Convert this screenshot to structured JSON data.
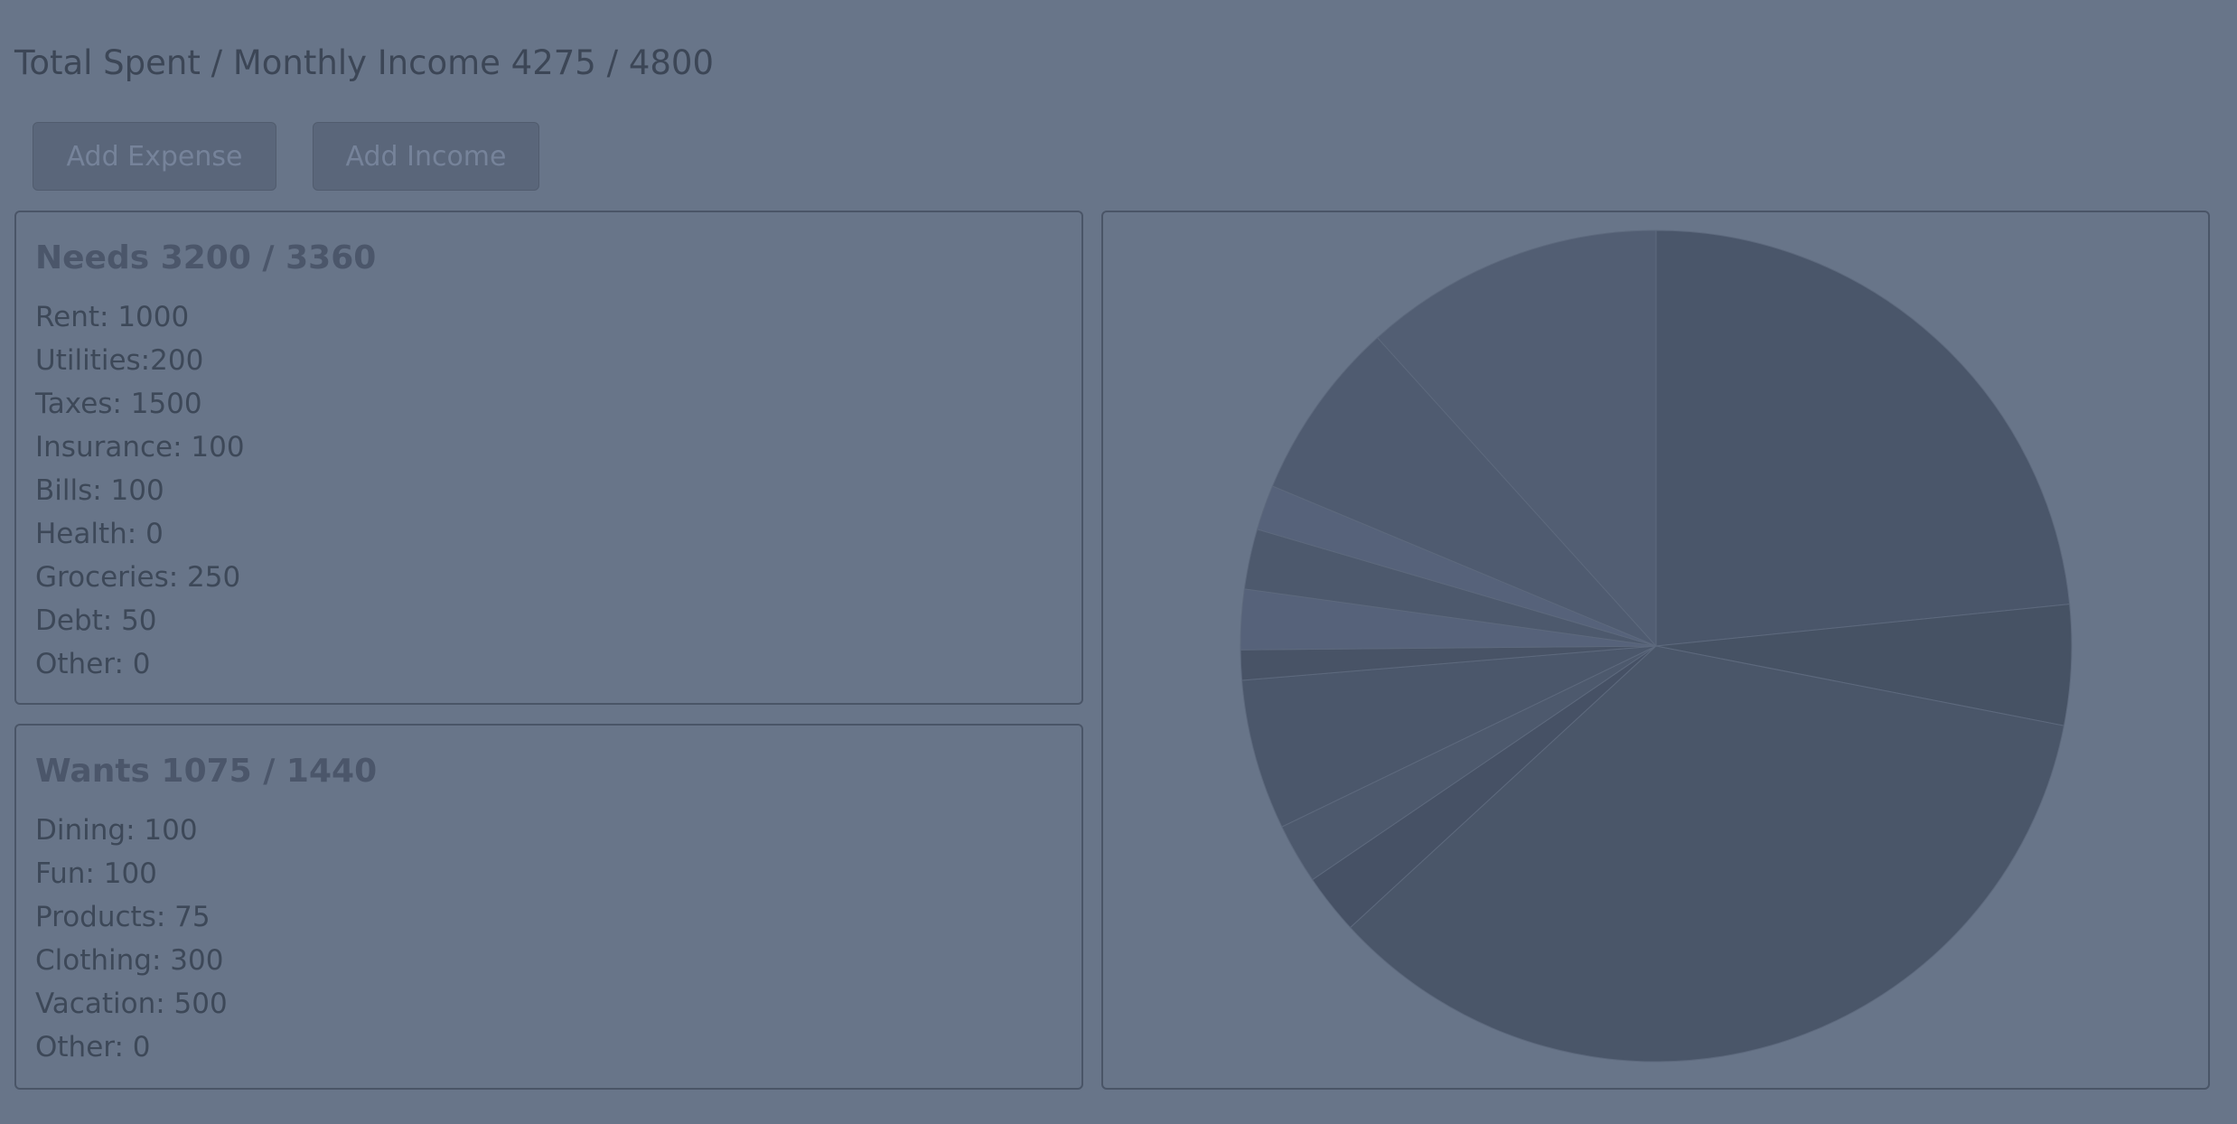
{
  "summary": "Total Spent / Monthly Income 4275 / 4800",
  "buttons": {
    "add_expense": "Add Expense",
    "add_income": "Add Income"
  },
  "needs": {
    "heading": "Needs 3200 / 3360",
    "items": [
      "Rent: 1000",
      "Utilities:200",
      "Taxes: 1500",
      "Insurance: 100",
      "Bills: 100",
      "Health: 0",
      "Groceries: 250",
      "Debt: 50",
      "Other: 0"
    ]
  },
  "wants": {
    "heading": "Wants 1075 / 1440",
    "items": [
      "Dining: 100",
      "Fun: 100",
      "Products: 75",
      "Clothing: 300",
      "Vacation: 500",
      "Other: 0"
    ]
  },
  "colors": {
    "background": "#687589",
    "button": "#5a667a",
    "text": "#3b4657"
  },
  "chart_data": {
    "type": "pie",
    "slices": [
      {
        "label": "Rent",
        "value": 1000,
        "color": "#4a566a"
      },
      {
        "label": "Utilities",
        "value": 200,
        "color": "#465264"
      },
      {
        "label": "Taxes",
        "value": 1500,
        "color": "#4a5669"
      },
      {
        "label": "Insurance",
        "value": 100,
        "color": "#465165"
      },
      {
        "label": "Bills",
        "value": 100,
        "color": "#4d596d"
      },
      {
        "label": "Health",
        "value": 0,
        "color": "#4c586c"
      },
      {
        "label": "Groceries",
        "value": 250,
        "color": "#4b576b"
      },
      {
        "label": "Debt",
        "value": 50,
        "color": "#485366"
      },
      {
        "label": "Other",
        "value": 0,
        "color": "#4c586c"
      },
      {
        "label": "Dining",
        "value": 100,
        "color": "#56627a"
      },
      {
        "label": "Fun",
        "value": 100,
        "color": "#4d596d"
      },
      {
        "label": "Products",
        "value": 75,
        "color": "#56627a"
      },
      {
        "label": "Clothing",
        "value": 300,
        "color": "#4f5b70"
      },
      {
        "label": "Vacation",
        "value": 500,
        "color": "#525e73"
      },
      {
        "label": "Other",
        "value": 0,
        "color": "#525e73"
      }
    ]
  }
}
